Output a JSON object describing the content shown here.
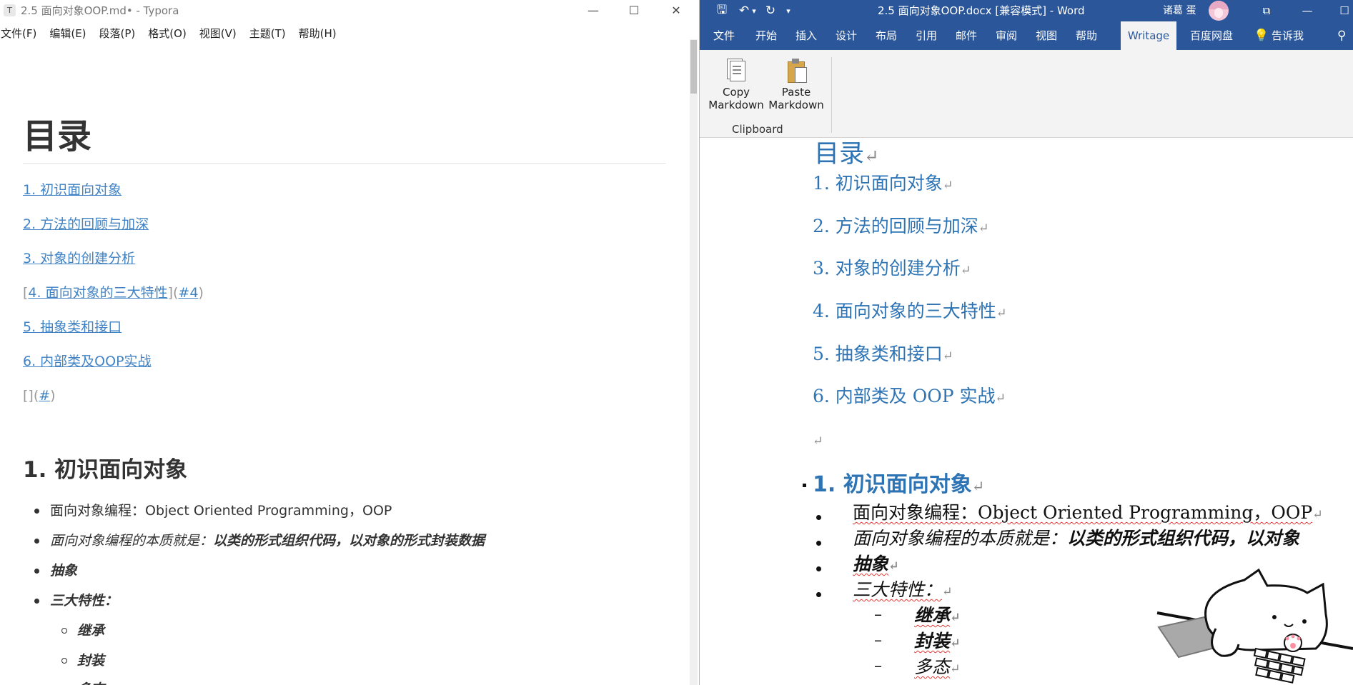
{
  "typora": {
    "app_icon": "T",
    "title": "2.5 面向对象OOP.md• - Typora",
    "window_controls": {
      "minimize": "—",
      "maximize": "☐",
      "close": "✕"
    },
    "menu": [
      "文件(F)",
      "编辑(E)",
      "段落(P)",
      "格式(O)",
      "视图(V)",
      "主题(T)",
      "帮助(H)"
    ],
    "heading": "目录",
    "toc": [
      "1. 初识面向对象",
      "2. 方法的回顾与加深",
      "3. 对象的创建分析",
      "4. 面向对象的三大特性",
      "5. 抽象类和接口",
      "6. 内部类及OOP实战"
    ],
    "toc4_raw": {
      "open": "[",
      "close": "](",
      "anchor": "#4",
      "end": ")"
    },
    "empty_link": {
      "text": "[](",
      "anchor": "#",
      "end": ")"
    },
    "section1_title": "1. 初识面向对象",
    "bullets": {
      "b1": "面向对象编程：Object Oriented Programming，OOP",
      "b2_prefix": "面向对象编程的本质就是：",
      "b2_bold": "以类的形式组织代码，以对象的形式封装数据",
      "b3": "抽象",
      "b4": "三大特性：",
      "sub1": "继承",
      "sub2": "封装",
      "sub3": "多态"
    }
  },
  "word": {
    "title": "2.5 面向对象OOP.docx [兼容模式]  -  Word",
    "user": "诸葛 蛋",
    "qat": {
      "save": "🖫",
      "undo": "↶",
      "undo_drop": "▾",
      "redo": "↻",
      "customize": "▾"
    },
    "window_controls": {
      "ribbon_display": "⧉",
      "minimize": "—",
      "maximize": "☐"
    },
    "tabs": [
      "文件",
      "开始",
      "插入",
      "设计",
      "布局",
      "引用",
      "邮件",
      "审阅",
      "视图",
      "帮助",
      "Writage",
      "百度网盘"
    ],
    "tell_me": "告诉我",
    "ribbon": {
      "copy_markdown": [
        "Copy",
        "Markdown"
      ],
      "paste_markdown": [
        "Paste",
        "Markdown"
      ],
      "group": "Clipboard"
    },
    "para_mark": "↵",
    "heading": "目录",
    "toc": [
      "1. 初识面向对象",
      "2. 方法的回顾与加深",
      "3. 对象的创建分析",
      "4. 面向对象的三大特性",
      "5. 抽象类和接口",
      "6. 内部类及 OOP 实战"
    ],
    "section1_title": "1. 初识面向对象",
    "bullets": {
      "b1": "面向对象编程：Object Oriented Programming，OOP",
      "b2_prefix": "面向对象编程的本质就是：",
      "b2_bold": "以类的形式组织代码，以对象",
      "b3": "抽象",
      "b4": "三大特性：",
      "sub1": "继承",
      "sub2": "封装",
      "sub3": "多态"
    },
    "dash": "–"
  }
}
